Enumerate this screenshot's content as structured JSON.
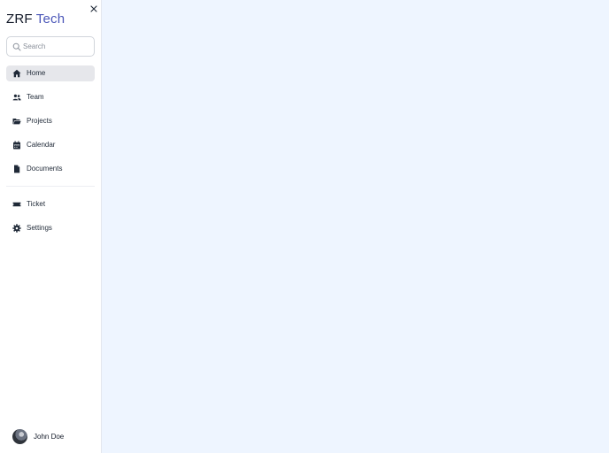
{
  "brand": {
    "part1": "ZRF",
    "part2": "Tech",
    "accent_color": "#4a56b8"
  },
  "search": {
    "placeholder": "Search",
    "value": ""
  },
  "nav": {
    "items": [
      {
        "label": "Home",
        "icon": "home-icon",
        "active": true
      },
      {
        "label": "Team",
        "icon": "users-icon",
        "active": false
      },
      {
        "label": "Projects",
        "icon": "folder-icon",
        "active": false
      },
      {
        "label": "Calendar",
        "icon": "calendar-icon",
        "active": false
      },
      {
        "label": "Documents",
        "icon": "document-icon",
        "active": false
      }
    ],
    "secondary": [
      {
        "label": "Ticket",
        "icon": "ticket-icon"
      },
      {
        "label": "Settings",
        "icon": "gear-icon"
      }
    ]
  },
  "user": {
    "name": "John Doe"
  },
  "colors": {
    "main_background": "#eef5ff",
    "active_item": "#e6e7eb"
  }
}
